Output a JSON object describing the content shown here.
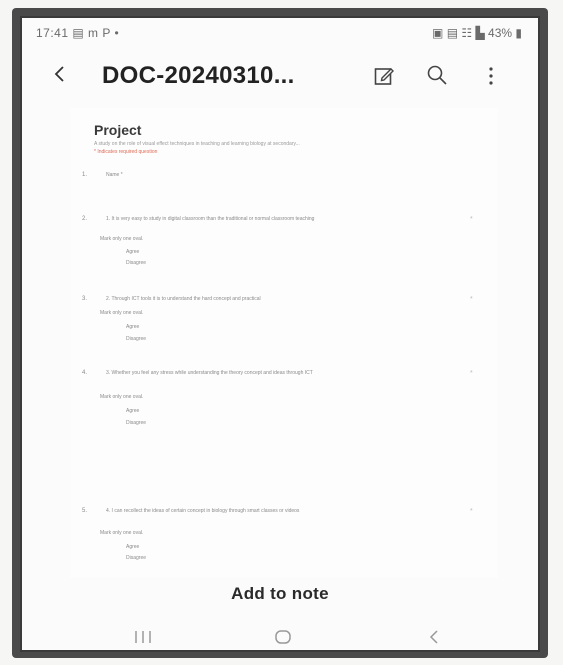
{
  "status_bar": {
    "time_and_icons": "17:41 ▤ m P •",
    "right_icons": "▣ ▤ ☷ ▙ 43% ▮"
  },
  "app_bar": {
    "title": "DOC-20240310...",
    "back_icon": "back-arrow",
    "edit_icon": "edit-note",
    "search_icon": "search",
    "more_icon": "more-vertical"
  },
  "document": {
    "title": "Project",
    "subtitle_line": "A study on the role of visual effect techniques in teaching and learning biology at secondary...",
    "required_note": "* Indicates required question",
    "items": [
      {
        "num": "1.",
        "text": "Name *"
      },
      {
        "num": "2.",
        "text": "1. It is very easy to study in digital classroom than the traditional or normal classroom teaching",
        "sub": "Mark only one oval.",
        "options": [
          "Agree",
          "Disagree"
        ]
      },
      {
        "num": "3.",
        "text": "2. Through ICT tools it is to understand the hard concept and practical",
        "sub": "Mark only one oval.",
        "options": [
          "Agree",
          "Disagree"
        ]
      },
      {
        "num": "4.",
        "text": "3. Whether you feel any stress while understanding the theory concept and ideas through ICT",
        "sub": "Mark only one oval.",
        "options": [
          "Agree",
          "Disagree"
        ]
      },
      {
        "num": "5.",
        "text": "4. I can recollect the ideas of certain concept in biology through smart classes or videos",
        "sub": "Mark only one oval.",
        "options": [
          "Agree",
          "Disagree"
        ]
      }
    ]
  },
  "actions": {
    "add_to_note": "Add to note"
  },
  "nav_bar": {
    "recents": "recents",
    "home": "home",
    "back": "back"
  }
}
